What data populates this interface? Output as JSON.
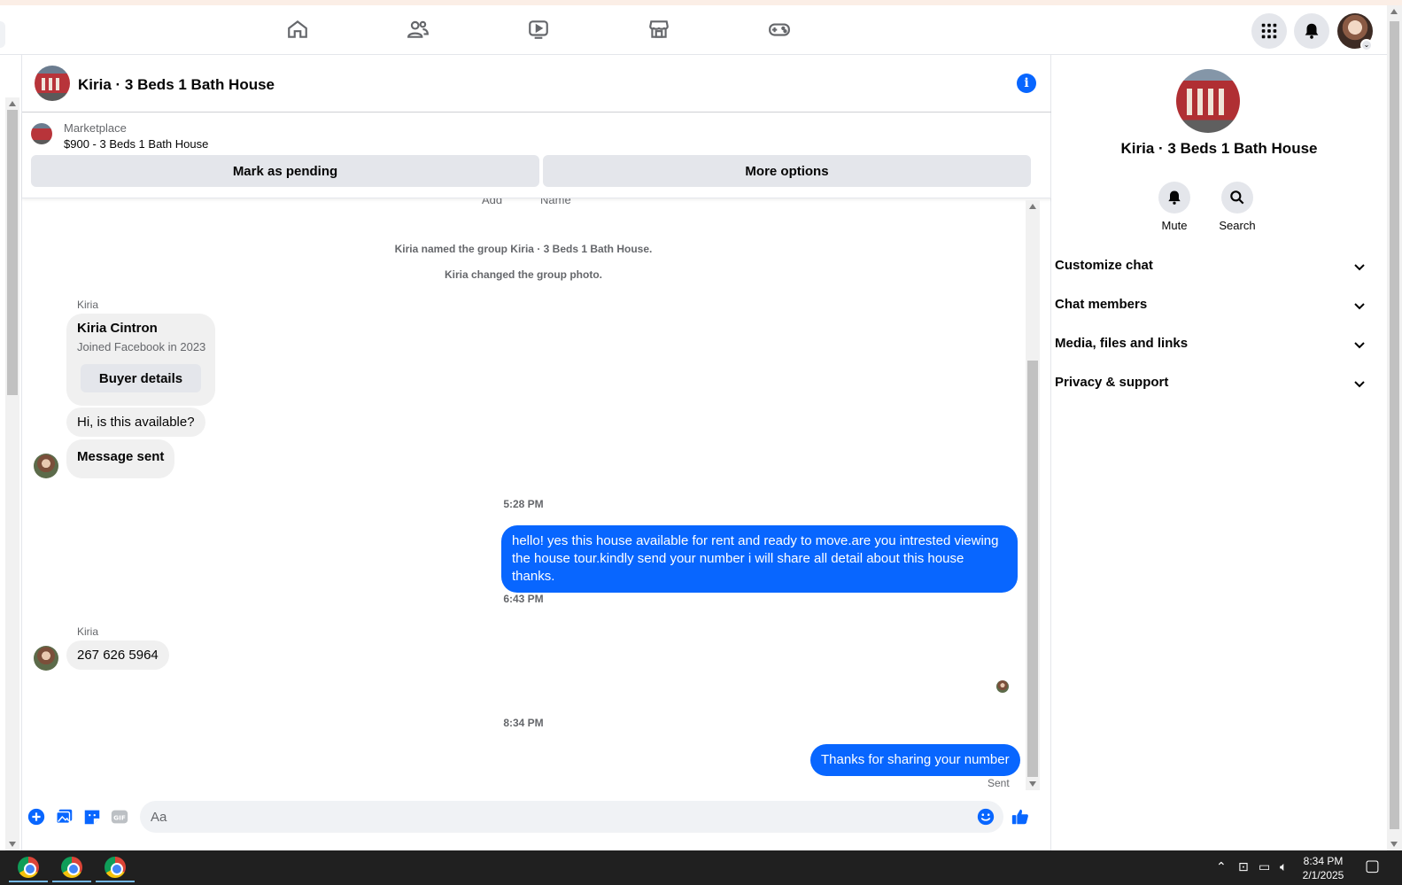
{
  "chat": {
    "title": "Kiria · 3 Beds 1 Bath House",
    "marketplace_label": "Marketplace",
    "listing": "$900 - 3 Beds 1 Bath House",
    "mark_pending": "Mark as pending",
    "more_options": "More options"
  },
  "messages": {
    "cut_left": "Add",
    "cut_right": "Name",
    "sys1": "Kiria named the group Kiria · 3 Beds 1 Bath House.",
    "sys2": "Kiria changed the group photo.",
    "sender1": "Kiria",
    "card_name": "Kiria Cintron",
    "card_sub": "Joined Facebook in 2023",
    "card_button": "Buyer details",
    "msg1": "Hi, is this available?",
    "msg2": "Message sent",
    "time1": "5:28 PM",
    "out1": "hello! yes this house available for rent and ready to move.are you intrested viewing the house tour.kindly send your number i will share all detail about this house thanks.",
    "time2": "6:43 PM",
    "sender2": "Kiria",
    "msg3": "267 626 5964",
    "time3": "8:34 PM",
    "out2": "Thanks for sharing your number",
    "sent_status": "Sent"
  },
  "composer": {
    "placeholder": "Aa"
  },
  "sidebar": {
    "title": "Kiria · 3 Beds 1 Bath House",
    "mute": "Mute",
    "search": "Search",
    "sections": [
      "Customize chat",
      "Chat members",
      "Media, files and links",
      "Privacy & support"
    ]
  },
  "taskbar": {
    "time": "8:34 PM",
    "date": "2/1/2025"
  },
  "colors": {
    "accent": "#0866ff",
    "bubble_in": "#f0f0f0",
    "taskbar": "#202020"
  }
}
